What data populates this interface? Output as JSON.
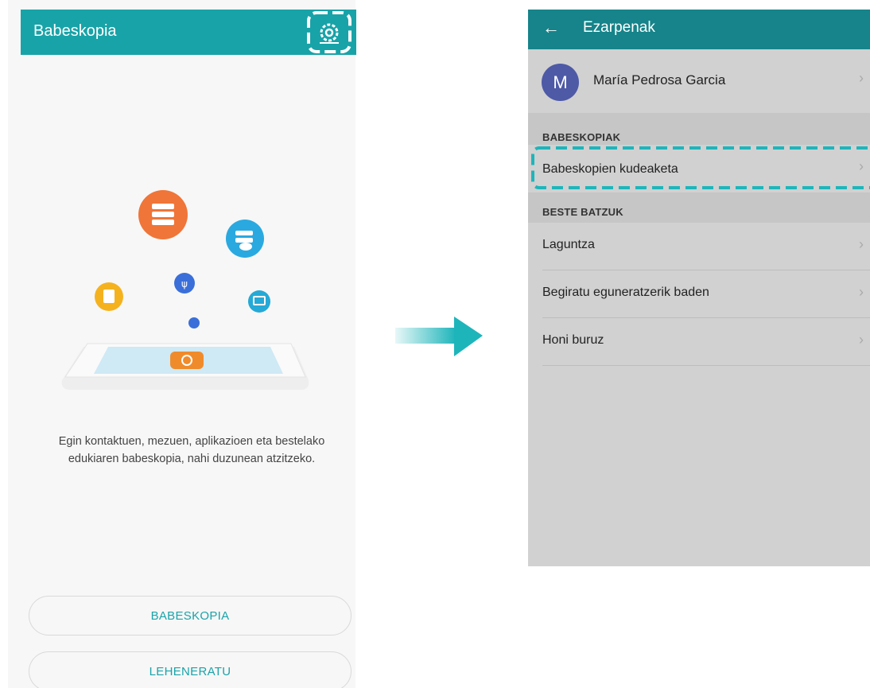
{
  "left": {
    "title": "Babeskopia",
    "settings_icon": "gear-icon",
    "description_line1": "Egin kontaktuen, mezuen, aplikazioen eta bestelako",
    "description_line2": "edukiaren babeskopia, nahi duzunean atzitzeko.",
    "backup_button": "BABESKOPIA",
    "restore_button": "LEHENERATU"
  },
  "right": {
    "back_icon": "back-arrow-icon",
    "title": "Ezarpenak",
    "profile": {
      "initial": "M",
      "name": "María Pedrosa Garcia"
    },
    "section_backups": "BABESKOPIAK",
    "manage_backups": "Babeskopien kudeaketa",
    "section_others": "BESTE BATZUK",
    "items": [
      "Laguntza",
      "Begiratu eguneratzerik baden",
      "Honi buruz"
    ]
  },
  "colors": {
    "accent": "#18a3a8",
    "header_dark": "#16848a",
    "avatar": "#4e5aa6"
  }
}
